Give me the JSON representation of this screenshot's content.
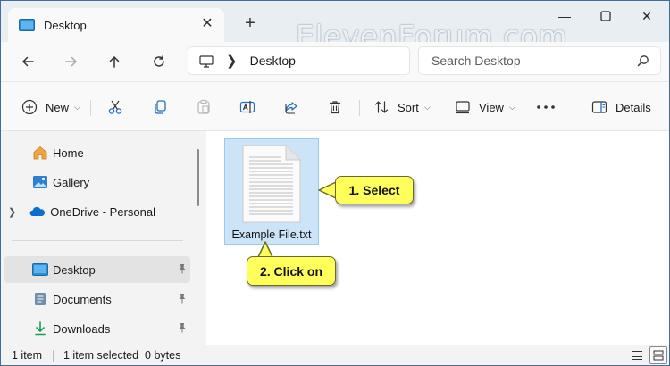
{
  "tab": {
    "title": "Desktop"
  },
  "watermark": "ElevenForum.com",
  "address": {
    "location": "Desktop"
  },
  "search": {
    "placeholder": "Search Desktop"
  },
  "commands": {
    "new_label": "New",
    "sort_label": "Sort",
    "view_label": "View",
    "details_label": "Details"
  },
  "sidebar": {
    "items": [
      {
        "label": "Home"
      },
      {
        "label": "Gallery"
      },
      {
        "label": "OneDrive - Personal"
      },
      {
        "label": "Desktop"
      },
      {
        "label": "Documents"
      },
      {
        "label": "Downloads"
      }
    ]
  },
  "content": {
    "files": [
      {
        "name": "Example File.txt"
      }
    ]
  },
  "callouts": {
    "step1": "1. Select",
    "step2": "2. Click on"
  },
  "status": {
    "item_count": "1 item",
    "selection": "1 item selected  0 bytes"
  },
  "colors": {
    "accent": "#0067c0",
    "selection": "#cce4f7",
    "callout": "#ffff5c"
  },
  "icons": [
    "folder-desktop-icon",
    "close-icon",
    "plus-icon",
    "back-arrow-icon",
    "forward-arrow-icon",
    "up-arrow-icon",
    "refresh-icon",
    "this-pc-icon",
    "chevron-right-icon",
    "search-icon",
    "new-icon",
    "cut-icon",
    "copy-icon",
    "paste-icon",
    "rename-icon",
    "share-icon",
    "delete-icon",
    "sort-icon",
    "view-icon",
    "more-icon",
    "details-pane-icon",
    "home-icon",
    "gallery-icon",
    "onedrive-icon",
    "documents-icon",
    "downloads-icon",
    "pin-icon",
    "text-file-icon",
    "details-view-icon",
    "tiles-view-icon"
  ]
}
